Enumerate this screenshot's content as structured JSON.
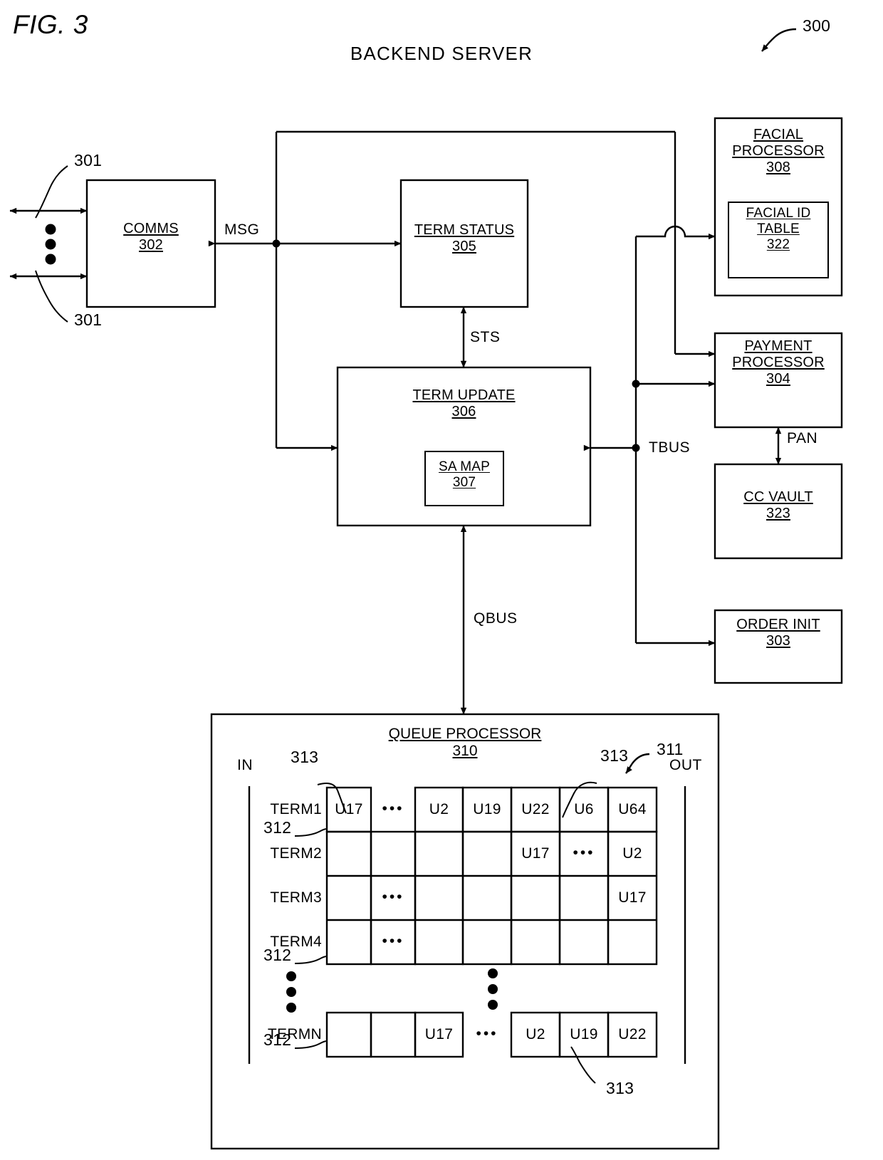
{
  "figure": {
    "label": "FIG. 3",
    "heading": "BACKEND SERVER",
    "system_ref": "300"
  },
  "blocks": {
    "comms": {
      "title": "COMMS",
      "ref": "302"
    },
    "term_status": {
      "title": "TERM STATUS",
      "ref": "305"
    },
    "term_update": {
      "title": "TERM UPDATE",
      "ref": "306"
    },
    "sa_map": {
      "title": "SA MAP",
      "ref": "307"
    },
    "facial_processor": {
      "title_line1": "FACIAL",
      "title_line2": "PROCESSOR",
      "ref": "308"
    },
    "facial_id_table": {
      "title_line1": "FACIAL ID",
      "title_line2": "TABLE",
      "ref": "322"
    },
    "payment_processor": {
      "title_line1": "PAYMENT",
      "title_line2": "PROCESSOR",
      "ref": "304"
    },
    "cc_vault": {
      "title": "CC VAULT",
      "ref": "323"
    },
    "order_init": {
      "title": "ORDER INIT",
      "ref": "303"
    },
    "queue_processor": {
      "title": "QUEUE PROCESSOR",
      "ref": "310"
    }
  },
  "signals": {
    "msg": "MSG",
    "sts": "STS",
    "tbus": "TBUS",
    "pan": "PAN",
    "qbus": "QBUS"
  },
  "callouts": {
    "terminal_link_top": "301",
    "terminal_link_bottom": "301",
    "queue_array": "311",
    "queue_row_a": "312",
    "queue_row_b": "312",
    "queue_row_c": "312",
    "queue_entry_a": "313",
    "queue_entry_b": "313",
    "queue_entry_c": "313"
  },
  "queue": {
    "in_label": "IN",
    "out_label": "OUT",
    "row_labels": [
      "TERM1",
      "TERM2",
      "TERM3",
      "TERM4",
      "TERMN"
    ],
    "rows": [
      {
        "label": "TERM1",
        "cells": [
          "U17",
          "•••",
          "U2",
          "U19",
          "U22",
          "U6",
          "U64"
        ]
      },
      {
        "label": "TERM2",
        "cells": [
          "",
          "",
          "",
          "",
          "U17",
          "•••",
          "U2"
        ]
      },
      {
        "label": "TERM3",
        "cells": [
          "",
          "•••",
          "",
          "",
          "",
          "",
          "U17"
        ]
      },
      {
        "label": "TERM4",
        "cells": [
          "",
          "•••",
          "",
          "",
          "",
          "",
          ""
        ]
      },
      {
        "label": "TERMN",
        "cells": [
          "",
          "",
          "U17",
          "•••",
          "U2",
          "U19",
          "U22"
        ]
      }
    ],
    "vertical_ellipsis_left": "•",
    "vertical_ellipsis_mid": "•"
  },
  "colors": {
    "stroke": "#000000",
    "background": "#ffffff"
  }
}
